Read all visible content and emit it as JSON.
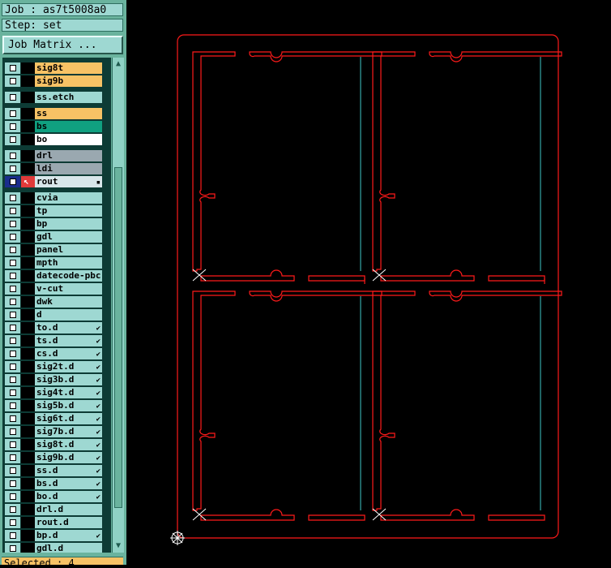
{
  "header": {
    "job_label": "Job : as7t5008a0",
    "step_label": "Step: set",
    "job_matrix_button": "Job Matrix ..."
  },
  "colors": {
    "panel_bg": "#6ab39e",
    "row_default": "#9ed8d2",
    "row_signal": "#f7c265",
    "row_bs": "#10a080",
    "row_bo": "#ffffff",
    "row_drill": "#9aa8b0",
    "row_rout": "#d8e6ea",
    "rout_outline": "#ff1a1a",
    "vcut_line": "#40c8c8"
  },
  "layers": [
    {
      "name": "sig8t",
      "color": "#f7c265"
    },
    {
      "name": "sig9b",
      "color": "#f7c265"
    },
    {
      "name": "ss.etch",
      "color": "#9ed8d2",
      "gap_before": true
    },
    {
      "name": "ss",
      "color": "#f7c265",
      "gap_before": true
    },
    {
      "name": "bs",
      "color": "#10a080"
    },
    {
      "name": "bo",
      "color": "#ffffff"
    },
    {
      "name": "drl",
      "color": "#9aa8b0",
      "gap_before": true
    },
    {
      "name": "ldi",
      "color": "#9aa8b0"
    },
    {
      "name": "rout",
      "color": "#d8e6ea",
      "active": true
    },
    {
      "name": "cvia",
      "color": "#9ed8d2",
      "gap_before": true
    },
    {
      "name": "tp",
      "color": "#9ed8d2"
    },
    {
      "name": "bp",
      "color": "#9ed8d2"
    },
    {
      "name": "gdl",
      "color": "#9ed8d2"
    },
    {
      "name": "panel",
      "color": "#9ed8d2"
    },
    {
      "name": "mpth",
      "color": "#9ed8d2"
    },
    {
      "name": "datecode-pbc",
      "color": "#9ed8d2"
    },
    {
      "name": "v-cut",
      "color": "#9ed8d2"
    },
    {
      "name": "dwk",
      "color": "#9ed8d2"
    },
    {
      "name": "d",
      "color": "#9ed8d2"
    },
    {
      "name": "to.d",
      "color": "#9ed8d2",
      "mark": true
    },
    {
      "name": "ts.d",
      "color": "#9ed8d2",
      "mark": true
    },
    {
      "name": "cs.d",
      "color": "#9ed8d2",
      "mark": true
    },
    {
      "name": "sig2t.d",
      "color": "#9ed8d2",
      "mark": true
    },
    {
      "name": "sig3b.d",
      "color": "#9ed8d2",
      "mark": true
    },
    {
      "name": "sig4t.d",
      "color": "#9ed8d2",
      "mark": true
    },
    {
      "name": "sig5b.d",
      "color": "#9ed8d2",
      "mark": true
    },
    {
      "name": "sig6t.d",
      "color": "#9ed8d2",
      "mark": true
    },
    {
      "name": "sig7b.d",
      "color": "#9ed8d2",
      "mark": true
    },
    {
      "name": "sig8t.d",
      "color": "#9ed8d2",
      "mark": true
    },
    {
      "name": "sig9b.d",
      "color": "#9ed8d2",
      "mark": true
    },
    {
      "name": "ss.d",
      "color": "#9ed8d2",
      "mark": true
    },
    {
      "name": "bs.d",
      "color": "#9ed8d2",
      "mark": true
    },
    {
      "name": "bo.d",
      "color": "#9ed8d2",
      "mark": true
    },
    {
      "name": "drl.d",
      "color": "#9ed8d2"
    },
    {
      "name": "rout.d",
      "color": "#9ed8d2"
    },
    {
      "name": "bp.d",
      "color": "#9ed8d2",
      "mark": true
    },
    {
      "name": "gdl.d",
      "color": "#9ed8d2"
    }
  ],
  "status": {
    "selected_text": "Selected : 4"
  },
  "icons": {
    "row_mark": "check-mark-icon",
    "active_layer": "work-layer-icon",
    "rout_handle": "expand-icon",
    "datum": "datum-crosshair-icon",
    "fiducial": "cross-x-icon",
    "scroll_up": "scroll-up-arrow-icon",
    "scroll_down": "scroll-down-arrow-icon"
  }
}
